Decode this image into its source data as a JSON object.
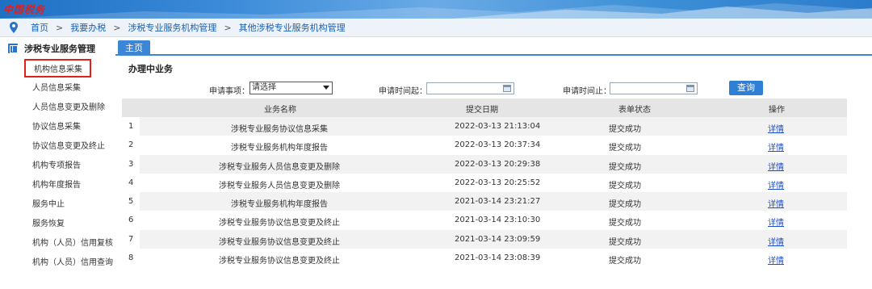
{
  "banner": {
    "logo_text": "中国税务"
  },
  "breadcrumb": {
    "items": [
      "首页",
      "我要办税",
      "涉税专业服务机构管理",
      "其他涉税专业服务机构管理"
    ],
    "separator": ">"
  },
  "sidebar": {
    "title": "涉税专业服务管理",
    "items": [
      "机构信息采集",
      "人员信息采集",
      "人员信息变更及删除",
      "协议信息采集",
      "协议信息变更及终止",
      "机构专项报告",
      "机构年度报告",
      "服务中止",
      "服务恢复",
      "机构（人员）信用复核",
      "机构（人员）信用查询"
    ],
    "active_index": 0
  },
  "tab": {
    "label": "主页"
  },
  "main": {
    "title": "办理中业务"
  },
  "filters": {
    "type_label": "申请事项：",
    "type_value": "请选择",
    "start_label": "申请时间起：",
    "end_label": "申请时间止：",
    "query_button": "查询"
  },
  "table": {
    "headers": [
      "业务名称",
      "提交日期",
      "表单状态",
      "操作"
    ],
    "rows": [
      {
        "idx": "1",
        "name": "涉税专业服务协议信息采集",
        "date": "2022-03-13 21:13:04",
        "status": "提交成功",
        "op": "详情"
      },
      {
        "idx": "2",
        "name": "涉税专业服务机构年度报告",
        "date": "2022-03-13 20:37:34",
        "status": "提交成功",
        "op": "详情"
      },
      {
        "idx": "3",
        "name": "涉税专业服务人员信息变更及删除",
        "date": "2022-03-13 20:29:38",
        "status": "提交成功",
        "op": "详情"
      },
      {
        "idx": "4",
        "name": "涉税专业服务人员信息变更及删除",
        "date": "2022-03-13 20:25:52",
        "status": "提交成功",
        "op": "详情"
      },
      {
        "idx": "5",
        "name": "涉税专业服务机构年度报告",
        "date": "2021-03-14 23:21:27",
        "status": "提交成功",
        "op": "详情"
      },
      {
        "idx": "6",
        "name": "涉税专业服务协议信息变更及终止",
        "date": "2021-03-14 23:10:30",
        "status": "提交成功",
        "op": "详情"
      },
      {
        "idx": "7",
        "name": "涉税专业服务协议信息变更及终止",
        "date": "2021-03-14 23:09:59",
        "status": "提交成功",
        "op": "详情"
      },
      {
        "idx": "8",
        "name": "涉税专业服务协议信息变更及终止",
        "date": "2021-03-14 23:08:39",
        "status": "提交成功",
        "op": "详情"
      }
    ]
  },
  "colors": {
    "accent": "#3d86d6",
    "link": "#1a4fd0",
    "highlight": "#e02020"
  }
}
